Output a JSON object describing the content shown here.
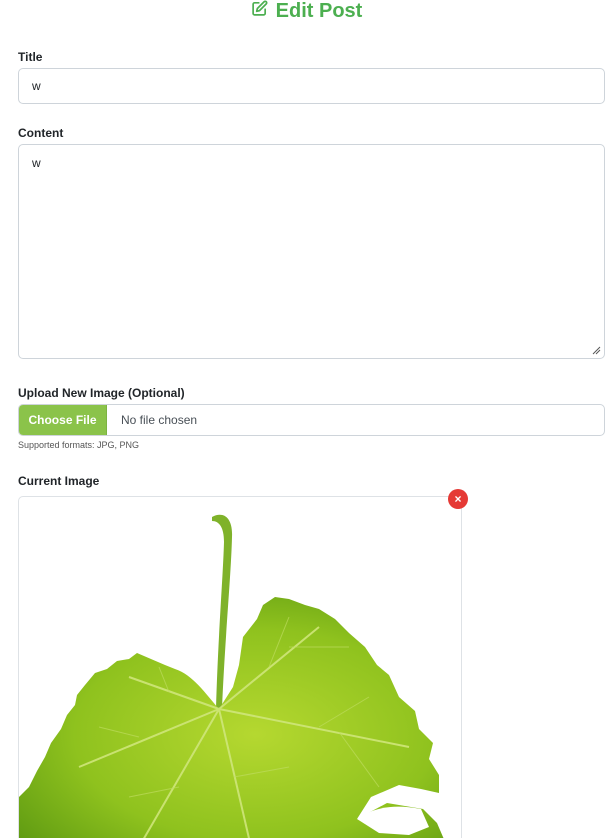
{
  "header": {
    "title": "Edit Post",
    "icon": "edit-icon",
    "color": "#4caf50"
  },
  "form": {
    "title_label": "Title",
    "title_value": "w",
    "content_label": "Content",
    "content_value": "w",
    "upload_label": "Upload New Image (Optional)",
    "choose_file_label": "Choose File",
    "file_status": "No file chosen",
    "supported_formats": "Supported formats: JPG, PNG",
    "current_image_label": "Current Image",
    "remove_symbol": "×"
  },
  "colors": {
    "accent": "#4caf50",
    "button": "#8bc34a",
    "remove": "#e53935"
  }
}
